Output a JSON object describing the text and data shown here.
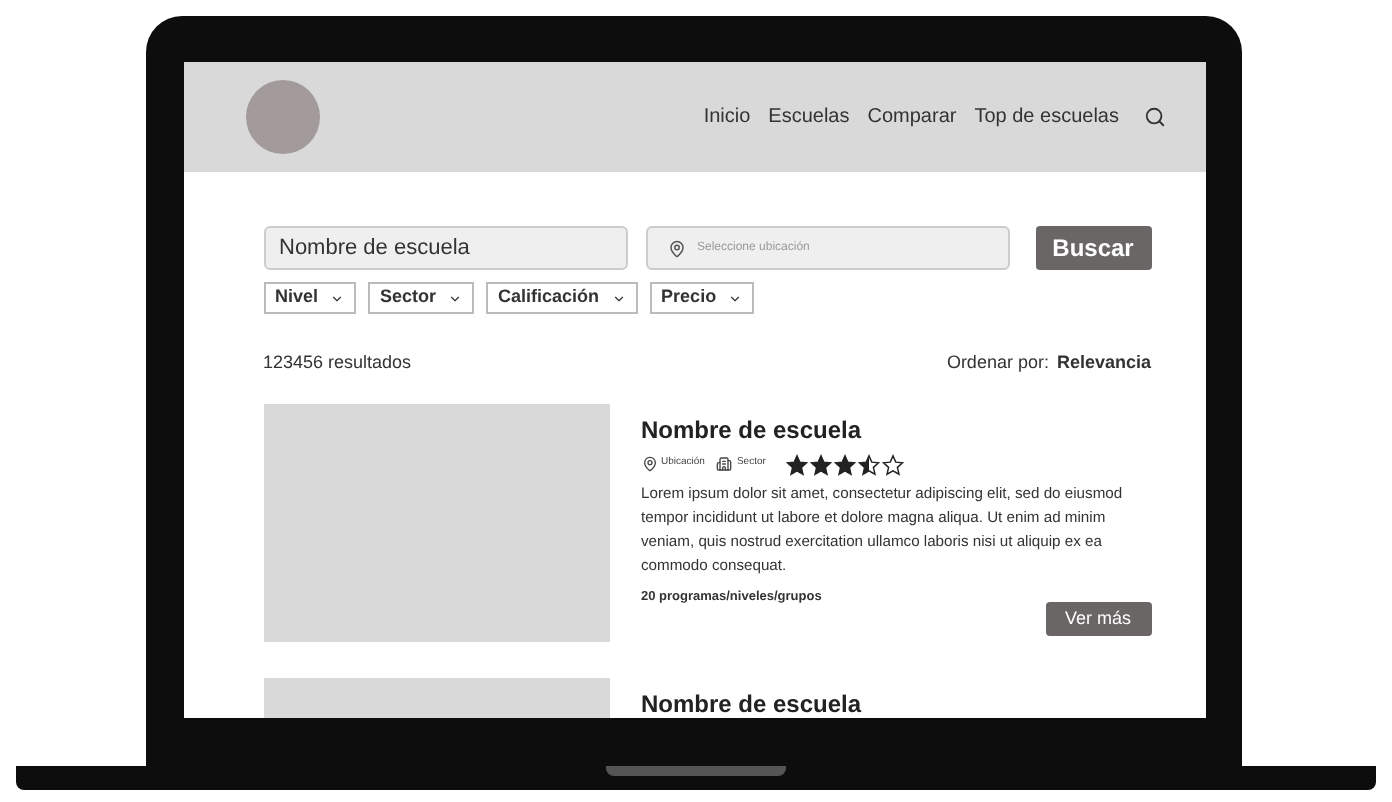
{
  "header": {
    "nav": [
      "Inicio",
      "Escuelas",
      "Comparar",
      "Top de escuelas"
    ]
  },
  "search": {
    "name_value": "Nombre de escuela",
    "location_placeholder": "Seleccione ubicación",
    "button": "Buscar"
  },
  "filters": [
    "Nivel",
    "Sector",
    "Calificación",
    "Precio"
  ],
  "results": {
    "count": "123456 resultados",
    "sort_label": "Ordenar por:",
    "sort_value": "Relevancia"
  },
  "schools": [
    {
      "name": "Nombre de escuela",
      "location": "Ubicación",
      "sector": "Sector",
      "stars": 3.5,
      "description": "Lorem ipsum dolor sit amet, consectetur adipiscing elit, sed do eiusmod tempor incididunt ut labore et dolore magna aliqua. Ut enim ad minim veniam, quis nostrud exercitation ullamco laboris nisi ut aliquip ex ea commodo consequat.",
      "programs": "20 programas/niveles/grupos",
      "button": "Ver más"
    },
    {
      "name": "Nombre de escuela"
    }
  ]
}
